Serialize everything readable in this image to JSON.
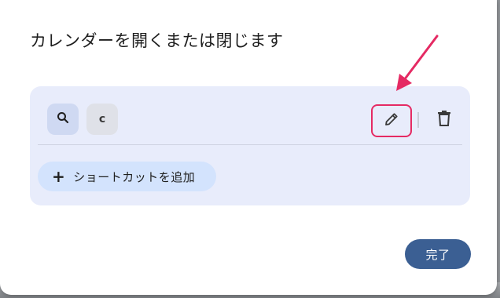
{
  "dialog": {
    "title": "カレンダーを開くまたは閉じます",
    "shortcut": {
      "keys": [
        "search-icon",
        "c"
      ],
      "actions": [
        "edit-icon",
        "trash-icon"
      ]
    },
    "add_shortcut_label": "ショートカットを追加",
    "done_label": "完了"
  },
  "colors": {
    "highlight": "#e52a63",
    "primary_button": "#3b5f93",
    "card": "#e8ecfb"
  }
}
